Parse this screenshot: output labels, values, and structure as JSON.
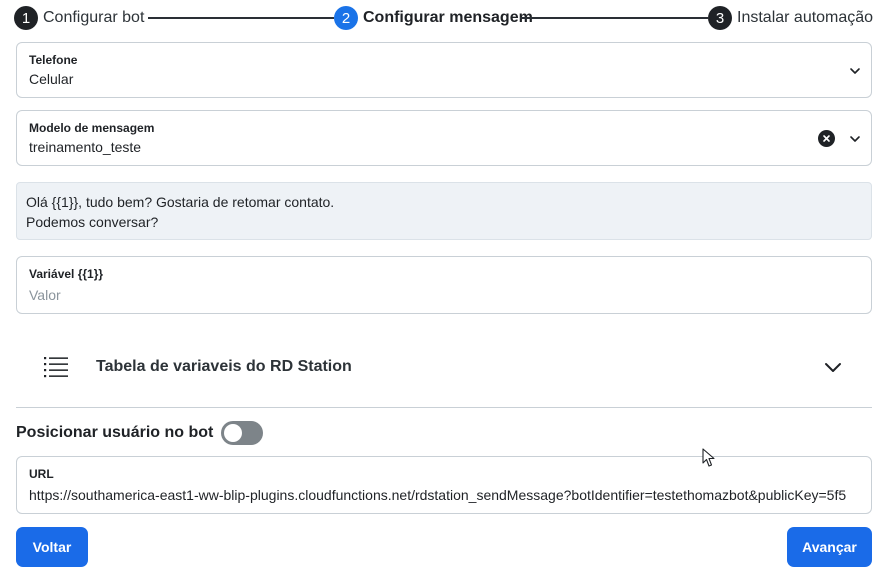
{
  "stepper": {
    "steps": [
      {
        "number": "1",
        "label": "Configurar bot",
        "active": false
      },
      {
        "number": "2",
        "label": "Configurar mensagem",
        "active": true
      },
      {
        "number": "3",
        "label": "Instalar automação",
        "active": false
      }
    ]
  },
  "phone_field": {
    "label": "Telefone",
    "value": "Celular"
  },
  "template_field": {
    "label": "Modelo de mensagem",
    "value": "treinamento_teste"
  },
  "message_preview": {
    "line1": "Olá {{1}}, tudo bem? Gostaria de retomar contato.",
    "line2": "Podemos conversar?"
  },
  "variable_field": {
    "label": "Variável {{1}}",
    "placeholder": "Valor"
  },
  "rd_table": {
    "title": "Tabela de variaveis do RD Station",
    "icon": "list-icon"
  },
  "position_toggle": {
    "label": "Posicionar usuário no bot",
    "on": false
  },
  "url_field": {
    "label": "URL",
    "value": "https://southamerica-east1-ww-blip-plugins.cloudfunctions.net/rdstation_sendMessage?botIdentifier=testethomazbot&publicKey=5f5"
  },
  "buttons": {
    "back": "Voltar",
    "next": "Avançar"
  },
  "colors": {
    "accent": "#1a6be8",
    "dark": "#1f2226",
    "border": "#c9d0d6",
    "message_bg": "#eef2f6"
  }
}
